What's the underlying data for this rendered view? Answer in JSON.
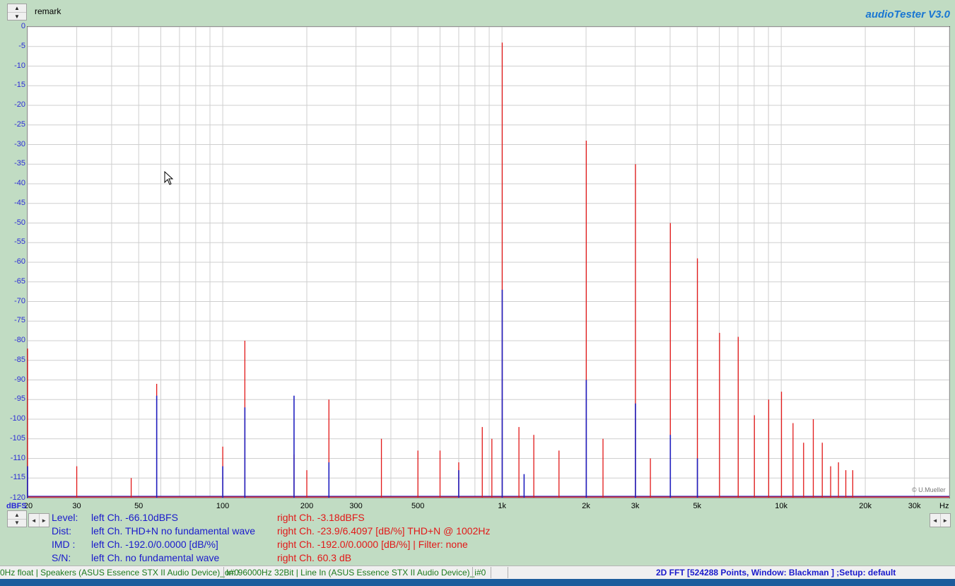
{
  "header": {
    "remark_label": "remark",
    "app_title": "audioTester  V3.0",
    "scroll_up": "▲",
    "scroll_down": "▼"
  },
  "plot": {
    "y_unit": "dBFS",
    "x_unit": "Hz",
    "copyright": "© U.Mueller",
    "y_ticks": [
      "0",
      "-5",
      "-10",
      "-15",
      "-20",
      "-25",
      "-30",
      "-35",
      "-40",
      "-45",
      "-50",
      "-55",
      "-60",
      "-65",
      "-70",
      "-75",
      "-80",
      "-85",
      "-90",
      "-95",
      "-100",
      "-105",
      "-110",
      "-115",
      "-120"
    ],
    "x_ticks": [
      "20",
      "30",
      "50",
      "100",
      "200",
      "300",
      "500",
      "1k",
      "2k",
      "3k",
      "5k",
      "10k",
      "20k",
      "30k"
    ]
  },
  "chart_data": {
    "type": "line",
    "xscale": "log",
    "xlim": [
      20,
      40000
    ],
    "ylim": [
      -120,
      0
    ],
    "ylabel": "dBFS",
    "xlabel": "Hz",
    "grid": true,
    "series": [
      {
        "color": "#e21818",
        "peaks": [
          {
            "f": 20,
            "db": -82
          },
          {
            "f": 30,
            "db": -112
          },
          {
            "f": 47,
            "db": -115
          },
          {
            "f": 58,
            "db": -91
          },
          {
            "f": 100,
            "db": -107
          },
          {
            "f": 120,
            "db": -80
          },
          {
            "f": 180,
            "db": -109
          },
          {
            "f": 200,
            "db": -113
          },
          {
            "f": 240,
            "db": -95
          },
          {
            "f": 370,
            "db": -105
          },
          {
            "f": 500,
            "db": -108
          },
          {
            "f": 600,
            "db": -108
          },
          {
            "f": 700,
            "db": -111
          },
          {
            "f": 850,
            "db": -102
          },
          {
            "f": 920,
            "db": -105
          },
          {
            "f": 1002,
            "db": -4
          },
          {
            "f": 1150,
            "db": -102
          },
          {
            "f": 1300,
            "db": -104
          },
          {
            "f": 1600,
            "db": -108
          },
          {
            "f": 2004,
            "db": -29
          },
          {
            "f": 2300,
            "db": -105
          },
          {
            "f": 3006,
            "db": -35
          },
          {
            "f": 3400,
            "db": -110
          },
          {
            "f": 4008,
            "db": -50
          },
          {
            "f": 5010,
            "db": -59
          },
          {
            "f": 6012,
            "db": -78
          },
          {
            "f": 7014,
            "db": -79
          },
          {
            "f": 8016,
            "db": -99
          },
          {
            "f": 9018,
            "db": -95
          },
          {
            "f": 10020,
            "db": -93
          },
          {
            "f": 11022,
            "db": -101
          },
          {
            "f": 12024,
            "db": -106
          },
          {
            "f": 13026,
            "db": -100
          },
          {
            "f": 14028,
            "db": -106
          },
          {
            "f": 15030,
            "db": -112
          },
          {
            "f": 16032,
            "db": -111
          },
          {
            "f": 17034,
            "db": -113
          },
          {
            "f": 18036,
            "db": -113
          }
        ]
      },
      {
        "color": "#2020c0",
        "peaks": [
          {
            "f": 20,
            "db": -112
          },
          {
            "f": 58,
            "db": -94
          },
          {
            "f": 100,
            "db": -112
          },
          {
            "f": 120,
            "db": -97
          },
          {
            "f": 180,
            "db": -94
          },
          {
            "f": 240,
            "db": -111
          },
          {
            "f": 1002,
            "db": -67
          },
          {
            "f": 2004,
            "db": -90
          },
          {
            "f": 3006,
            "db": -96
          },
          {
            "f": 4008,
            "db": -104
          },
          {
            "f": 5010,
            "db": -110
          },
          {
            "f": 700,
            "db": -113
          },
          {
            "f": 1200,
            "db": -114
          }
        ]
      }
    ]
  },
  "readouts": {
    "level": {
      "label": "Level:",
      "left": "left Ch. -66.10dBFS",
      "right": "right Ch. -3.18dBFS"
    },
    "dist": {
      "label": "Dist:",
      "left": "left Ch. THD+N  no fundamental wave",
      "right": "right Ch. -23.9/6.4097 [dB/%] THD+N  @ 1002Hz"
    },
    "imd": {
      "label": "IMD  :",
      "left": "left Ch. -192.0/0.0000 [dB/%]",
      "right": "right Ch. -192.0/0.0000 [dB/%] |   Filter: none"
    },
    "sn": {
      "label": "S/N:",
      "left": "left Ch.  no fundamental wave",
      "right": "right Ch. 60.3 dB"
    }
  },
  "scroll": {
    "left": "◄",
    "right": "►"
  },
  "statusbar": {
    "seg1": "0Hz float  | Speakers (ASUS Essence STX II Audio Device)_o#0",
    "seg2": "In: 96000Hz 32Bit  | Line In (ASUS Essence STX II Audio Device)_i#0",
    "fft": "2D FFT [524288 Points, Window: Blackman ]  ;Setup:  default"
  }
}
